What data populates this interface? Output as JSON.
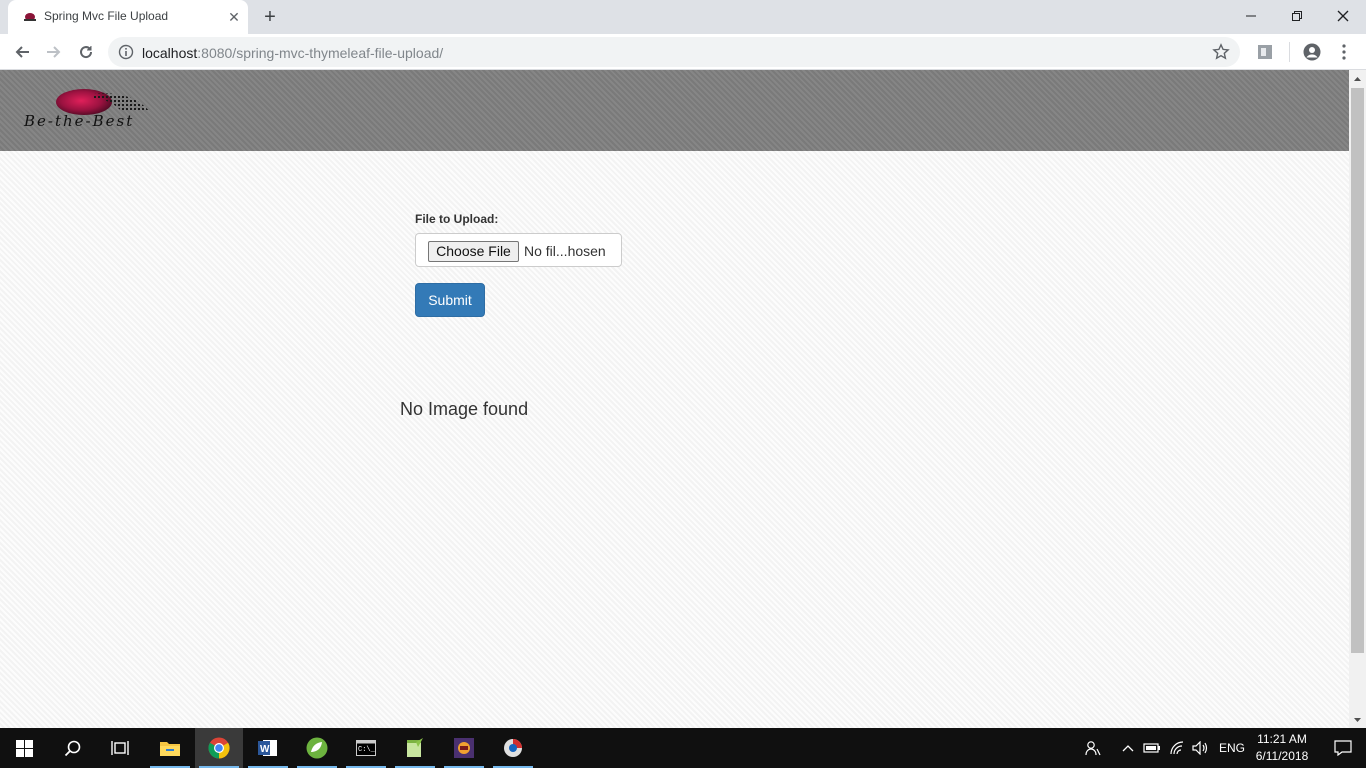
{
  "browser": {
    "tab_title": "Spring Mvc File Upload",
    "url_host": "localhost",
    "url_rest": ":8080/spring-mvc-thymeleaf-file-upload/"
  },
  "page": {
    "logo_text": "Be-the-Best",
    "file_label": "File to Upload:",
    "choose_file_label": "Choose File",
    "file_status": "No fil...hosen",
    "submit_label": "Submit",
    "no_image_text": "No Image found"
  },
  "taskbar": {
    "apps": [
      "start-icon",
      "search-icon",
      "task-view-icon",
      "file-explorer-icon",
      "chrome-icon",
      "word-icon",
      "spring-tool-suite-icon",
      "terminal-icon",
      "notepad-plus-plus-icon",
      "media-app-icon",
      "app-icon"
    ],
    "language": "ENG",
    "time": "11:21 AM",
    "date": "6/11/2018"
  }
}
